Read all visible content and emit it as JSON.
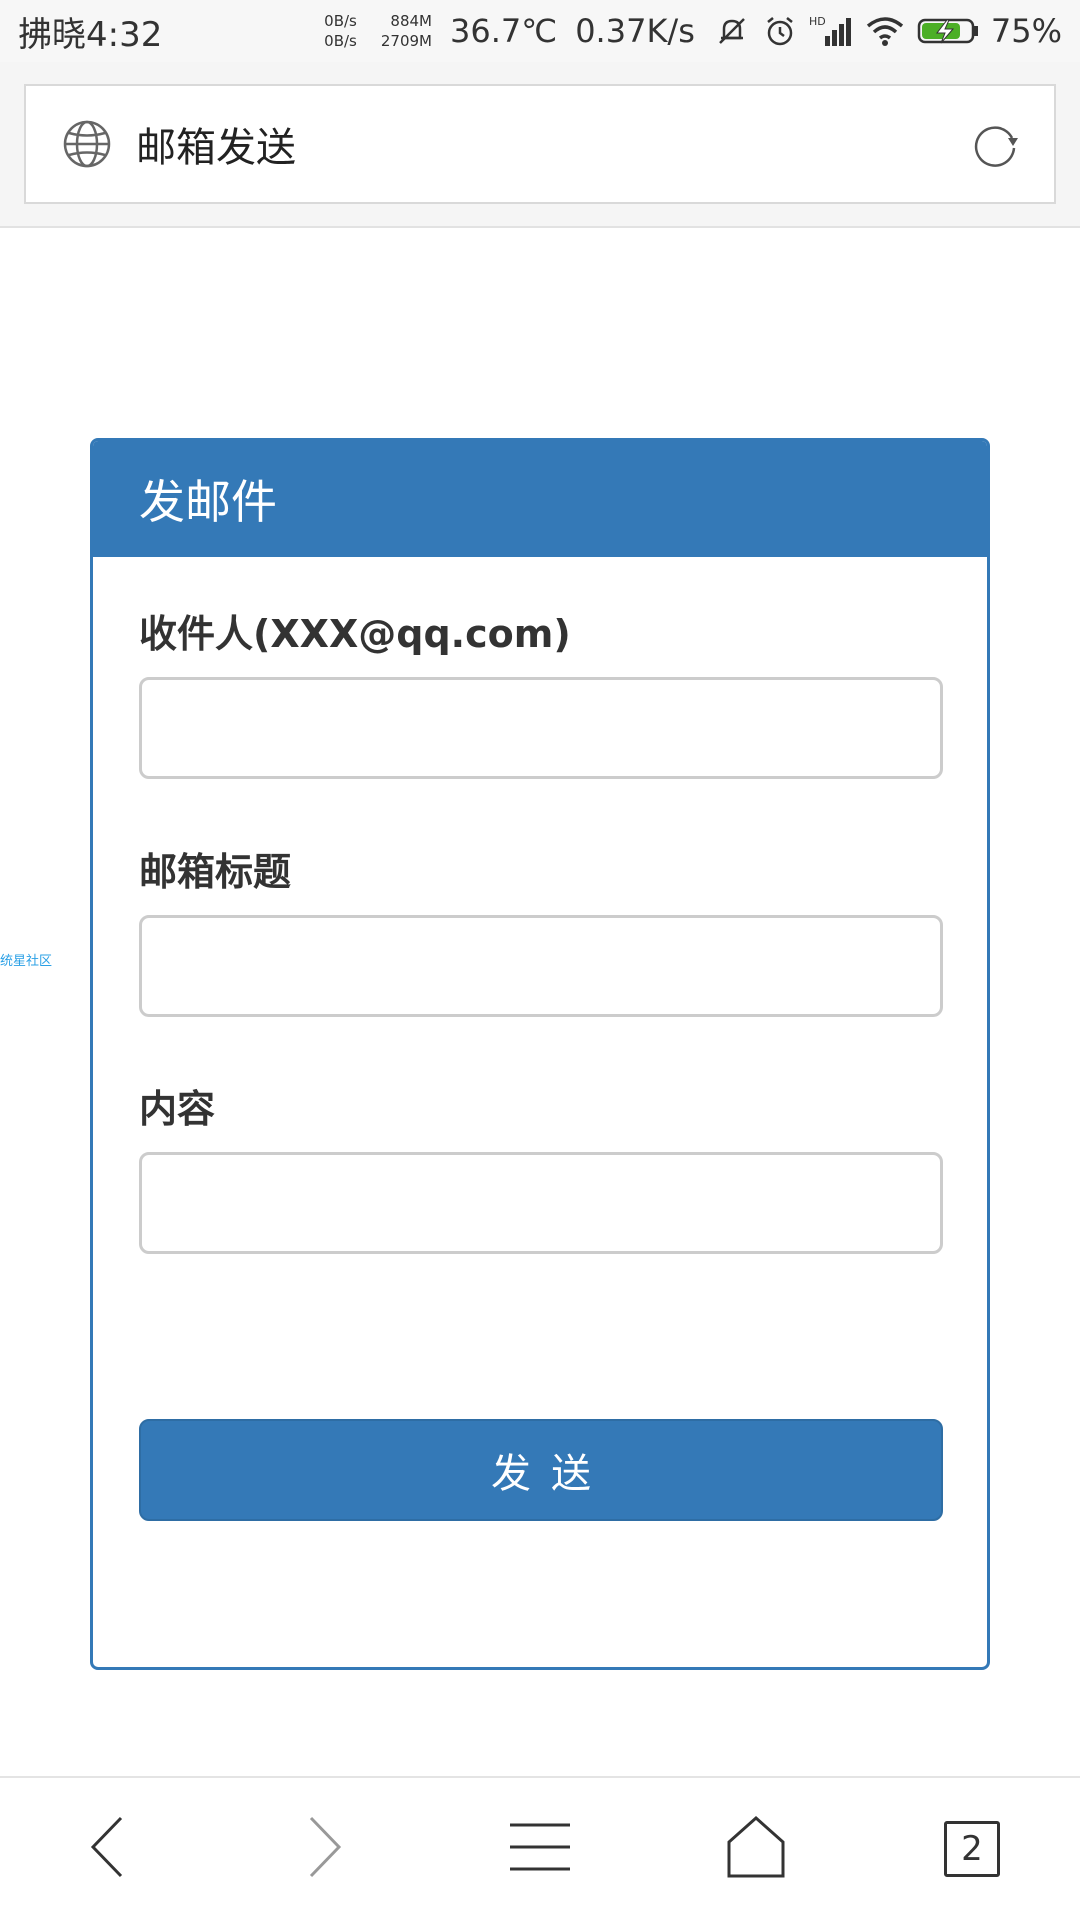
{
  "status_bar": {
    "time": "拂晓4:32",
    "net_up": "0B/s",
    "net_down": "0B/s",
    "mem_used": "884M",
    "mem_total": "2709M",
    "temperature": "36.7℃",
    "speed": "0.37K/s",
    "network_type": "HD",
    "battery": "75%",
    "battery_color": "#4caf26"
  },
  "address_bar": {
    "title": "邮箱发送"
  },
  "card": {
    "header": "发邮件",
    "accent_color": "#3479b7",
    "fields": [
      {
        "label": "收件人(XXX@qq.com)",
        "value": "",
        "placeholder": ""
      },
      {
        "label": "邮箱标题",
        "value": "",
        "placeholder": ""
      },
      {
        "label": "内容",
        "value": "",
        "placeholder": ""
      }
    ],
    "submit_label": "发送"
  },
  "side_link": "统星社区",
  "bottom_nav": {
    "items": [
      "back-icon",
      "forward-icon",
      "menu-icon",
      "home-icon",
      "tabs-icon"
    ],
    "tab_count": "2"
  }
}
